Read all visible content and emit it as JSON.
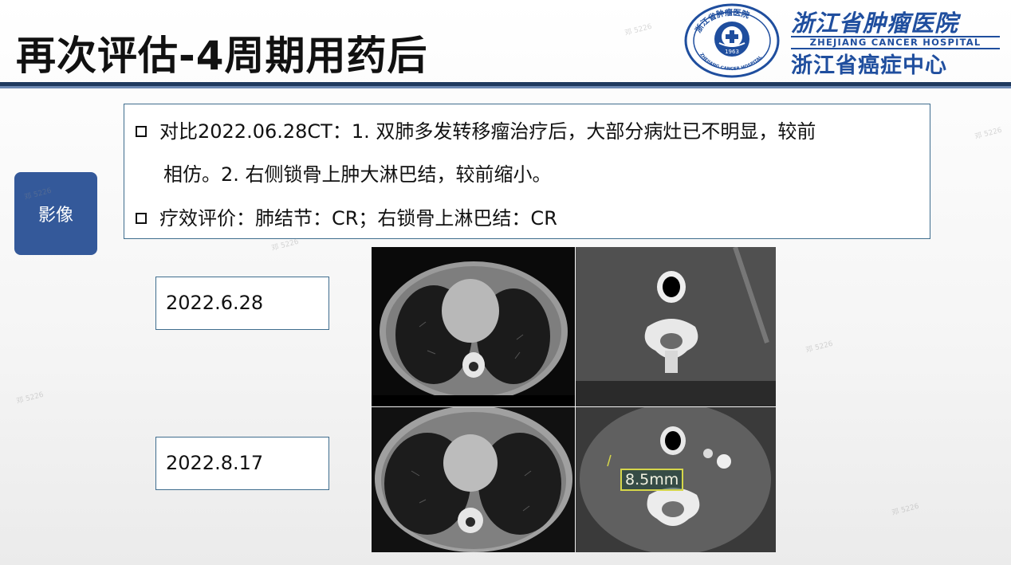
{
  "slide": {
    "title": "再次评估-4周期用药后",
    "section_tag": "影像"
  },
  "logo": {
    "name_cn": "浙江省肿瘤医院",
    "name_en": "ZHEJIANG CANCER HOSPITAL",
    "subtitle": "浙江省癌症中心",
    "seal_year": "1963",
    "seal_text_top": "浙江省肿瘤医院",
    "seal_text_bottom": "ZHEJIANG CANCER HOSPITAL"
  },
  "summary": {
    "line1": "对比2022.06.28CT：1. 双肺多发转移瘤治疗后，大部分病灶已不明显，较前",
    "line2": "相仿。2. 右侧锁骨上肿大淋巴结，较前缩小。",
    "line3": "疗效评价：肺结节：CR；右锁骨上淋巴结：CR"
  },
  "dates": {
    "first": "2022.6.28",
    "second": "2022.8.17"
  },
  "images": {
    "measurement": "8.5mm"
  },
  "watermark": "邓 5226",
  "colors": {
    "brand_blue": "#1f4e9e",
    "title_rule": "#1f3a5f",
    "tag_bg": "#34599a",
    "box_border": "#3f6d8e",
    "measure_outline": "#d5d64a"
  }
}
